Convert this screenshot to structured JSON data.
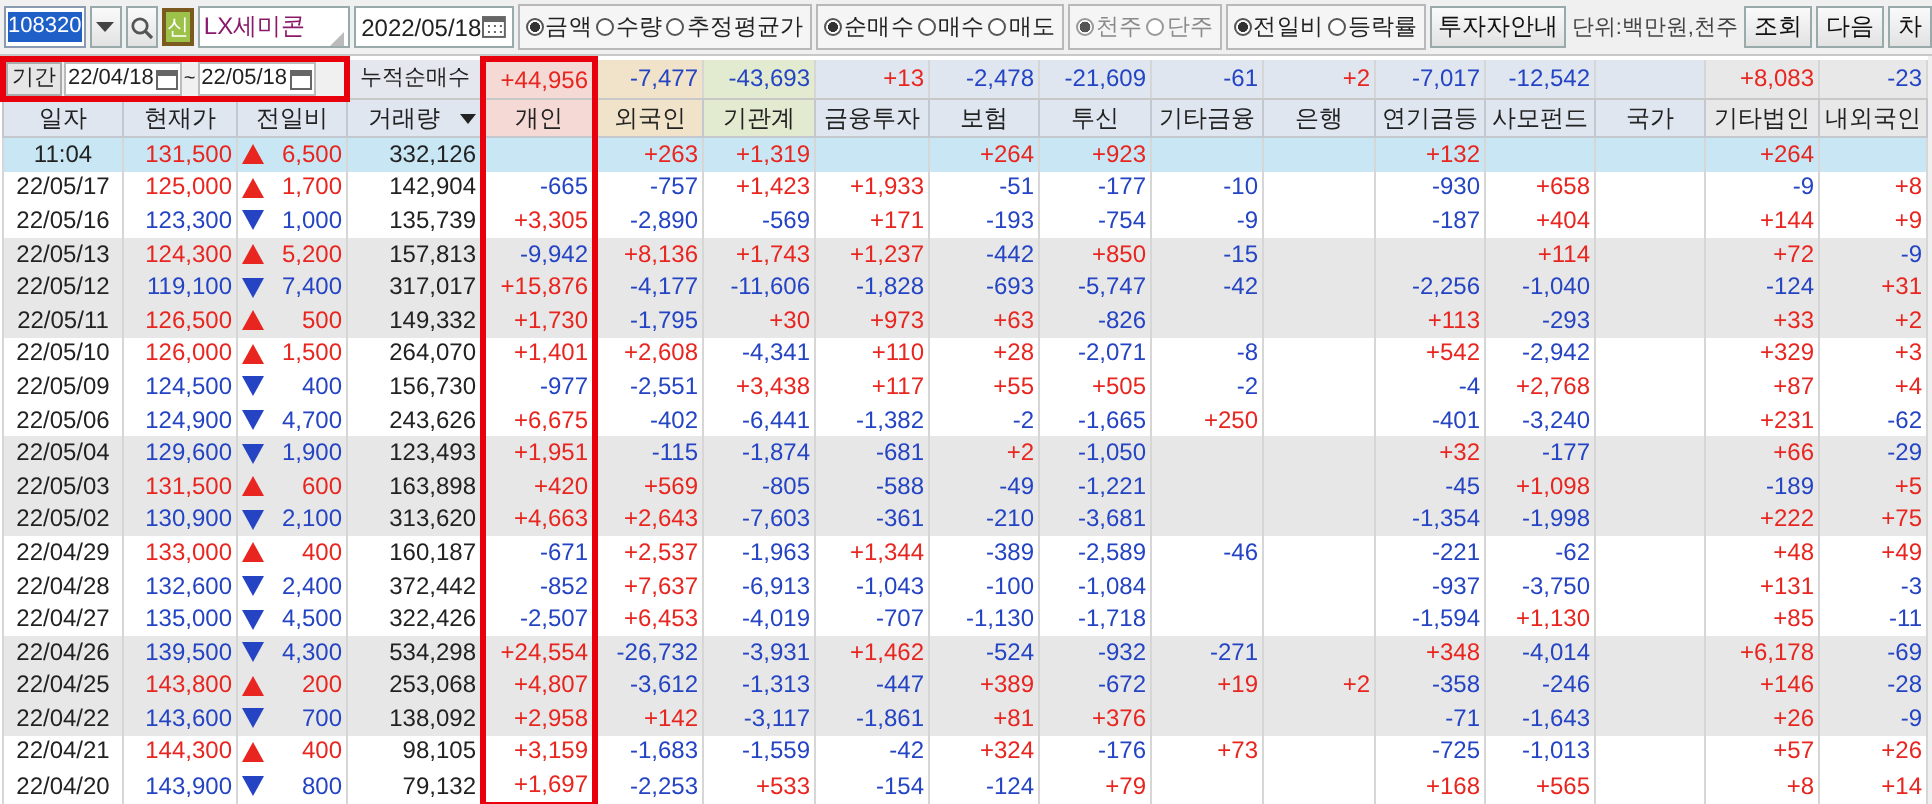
{
  "toolbar": {
    "code": "108320",
    "new_badge": "신",
    "name": "LX세미콘",
    "date": "2022/05/18",
    "radio_groups": [
      {
        "disabled": false,
        "options": [
          {
            "label": "금액",
            "selected": true
          },
          {
            "label": "수량",
            "selected": false
          },
          {
            "label": "추정평균가",
            "selected": false
          }
        ]
      },
      {
        "disabled": false,
        "options": [
          {
            "label": "순매수",
            "selected": true
          },
          {
            "label": "매수",
            "selected": false
          },
          {
            "label": "매도",
            "selected": false
          }
        ]
      },
      {
        "disabled": true,
        "options": [
          {
            "label": "천주",
            "selected": true
          },
          {
            "label": "단주",
            "selected": false
          }
        ]
      },
      {
        "disabled": false,
        "options": [
          {
            "label": "전일비",
            "selected": true
          },
          {
            "label": "등락률",
            "selected": false
          }
        ]
      }
    ],
    "guide_button": "투자자안내",
    "unit": "단위:백만원,천주",
    "buttons": [
      "조회",
      "다음",
      "차"
    ]
  },
  "period": {
    "label": "기간",
    "from": "22/04/18",
    "separator": "~",
    "to": "22/05/18",
    "outlined": true
  },
  "summary_label": "누적순매수",
  "columns": [
    {
      "label": "일자",
      "kind": "plain"
    },
    {
      "label": "현재가",
      "kind": "plain"
    },
    {
      "label": "전일비",
      "kind": "plain"
    },
    {
      "label": "거래량",
      "kind": "dropdown"
    }
  ],
  "investor_columns": [
    {
      "label": "개인",
      "color": "#f5d9d5",
      "outlined": true,
      "total": "+44,956"
    },
    {
      "label": "외국인",
      "color": "#f0e3c9",
      "outlined": false,
      "total": "-7,477"
    },
    {
      "label": "기관계",
      "color": "#e2eacf",
      "outlined": false,
      "total": "-43,693"
    },
    {
      "label": "금융투자",
      "color": "#dfe6ef",
      "outlined": false,
      "total": "+13"
    },
    {
      "label": "보험",
      "color": "#dfe6ef",
      "outlined": false,
      "total": "-2,478"
    },
    {
      "label": "투신",
      "color": "#dfe6ef",
      "outlined": false,
      "total": "-21,609"
    },
    {
      "label": "기타금융",
      "color": "#dfe6ef",
      "outlined": false,
      "total": "-61"
    },
    {
      "label": "은행",
      "color": "#dfe6ef",
      "outlined": false,
      "total": "+2"
    },
    {
      "label": "연기금등",
      "color": "#dfe6ef",
      "outlined": false,
      "total": "-7,017"
    },
    {
      "label": "사모펀드",
      "color": "#dfe6ef",
      "outlined": false,
      "total": "-12,542"
    },
    {
      "label": "국가",
      "color": "#dfe6ef",
      "outlined": false
    },
    {
      "label": "기타법인",
      "color": "#e8e8e8",
      "outlined": false,
      "total": "+8,083"
    },
    {
      "label": "내외국인",
      "color": "#e8e8e8",
      "outlined": false,
      "total": "-23"
    }
  ],
  "rows": [
    {
      "date": "11:04",
      "price": "131,500",
      "rising": true,
      "change": "6,500",
      "volume": "332,126",
      "selected": true,
      "values": [
        {
          "kind": "empty"
        },
        "+263",
        "+1,319",
        {
          "kind": "empty"
        },
        "+264",
        "+923",
        {
          "kind": "empty"
        },
        {
          "kind": "empty"
        },
        "+132",
        {
          "kind": "empty"
        },
        {
          "kind": "empty"
        },
        "+264",
        {
          "kind": "empty"
        }
      ]
    },
    {
      "date": "22/05/17",
      "price": "125,000",
      "rising": true,
      "change": "1,700",
      "volume": "142,904",
      "selected": false,
      "values": [
        "-665",
        "-757",
        "+1,423",
        "+1,933",
        "-51",
        "-177",
        "-10",
        {
          "kind": "empty"
        },
        "-930",
        "+658",
        {
          "kind": "empty"
        },
        "-9",
        "+8"
      ]
    },
    {
      "date": "22/05/16",
      "price": "123,300",
      "rising": false,
      "change": "1,000",
      "volume": "135,739",
      "selected": false,
      "values": [
        "+3,305",
        "-2,890",
        "-569",
        "+171",
        "-193",
        "-754",
        "-9",
        {
          "kind": "empty"
        },
        "-187",
        "+404",
        {
          "kind": "empty"
        },
        "+144",
        "+9"
      ]
    },
    {
      "date": "22/05/13",
      "price": "124,300",
      "rising": true,
      "change": "5,200",
      "volume": "157,813",
      "selected": false,
      "values": [
        "-9,942",
        "+8,136",
        "+1,743",
        "+1,237",
        "-442",
        "+850",
        "-15",
        {
          "kind": "empty"
        },
        {
          "kind": "empty"
        },
        "+114",
        {
          "kind": "empty"
        },
        "+72",
        "-9"
      ]
    },
    {
      "date": "22/05/12",
      "price": "119,100",
      "rising": false,
      "change": "7,400",
      "volume": "317,017",
      "selected": false,
      "values": [
        "+15,876",
        "-4,177",
        "-11,606",
        "-1,828",
        "-693",
        "-5,747",
        "-42",
        {
          "kind": "empty"
        },
        "-2,256",
        "-1,040",
        {
          "kind": "empty"
        },
        "-124",
        "+31"
      ]
    },
    {
      "date": "22/05/11",
      "price": "126,500",
      "rising": true,
      "change": "500",
      "volume": "149,332",
      "selected": false,
      "values": [
        "+1,730",
        "-1,795",
        "+30",
        "+973",
        "+63",
        "-826",
        {
          "kind": "empty"
        },
        {
          "kind": "empty"
        },
        "+113",
        "-293",
        {
          "kind": "empty"
        },
        "+33",
        "+2"
      ]
    },
    {
      "date": "22/05/10",
      "price": "126,000",
      "rising": true,
      "change": "1,500",
      "volume": "264,070",
      "selected": false,
      "values": [
        "+1,401",
        "+2,608",
        "-4,341",
        "+110",
        "+28",
        "-2,071",
        "-8",
        {
          "kind": "empty"
        },
        "+542",
        "-2,942",
        {
          "kind": "empty"
        },
        "+329",
        "+3"
      ]
    },
    {
      "date": "22/05/09",
      "price": "124,500",
      "rising": false,
      "change": "400",
      "volume": "156,730",
      "selected": false,
      "values": [
        "-977",
        "-2,551",
        "+3,438",
        "+117",
        "+55",
        "+505",
        "-2",
        {
          "kind": "empty"
        },
        "-4",
        "+2,768",
        {
          "kind": "empty"
        },
        "+87",
        "+4"
      ]
    },
    {
      "date": "22/05/06",
      "price": "124,900",
      "rising": false,
      "change": "4,700",
      "volume": "243,626",
      "selected": false,
      "values": [
        "+6,675",
        "-402",
        "-6,441",
        "-1,382",
        "-2",
        "-1,665",
        "+250",
        {
          "kind": "empty"
        },
        "-401",
        "-3,240",
        {
          "kind": "empty"
        },
        "+231",
        "-62"
      ]
    },
    {
      "date": "22/05/04",
      "price": "129,600",
      "rising": false,
      "change": "1,900",
      "volume": "123,493",
      "selected": false,
      "values": [
        "+1,951",
        "-115",
        "-1,874",
        "-681",
        "+2",
        "-1,050",
        {
          "kind": "empty"
        },
        {
          "kind": "empty"
        },
        "+32",
        "-177",
        {
          "kind": "empty"
        },
        "+66",
        "-29"
      ]
    },
    {
      "date": "22/05/03",
      "price": "131,500",
      "rising": true,
      "change": "600",
      "volume": "163,898",
      "selected": false,
      "values": [
        "+420",
        "+569",
        "-805",
        "-588",
        "-49",
        "-1,221",
        {
          "kind": "empty"
        },
        {
          "kind": "empty"
        },
        "-45",
        "+1,098",
        {
          "kind": "empty"
        },
        "-189",
        "+5"
      ]
    },
    {
      "date": "22/05/02",
      "price": "130,900",
      "rising": false,
      "change": "2,100",
      "volume": "313,620",
      "selected": false,
      "values": [
        "+4,663",
        "+2,643",
        "-7,603",
        "-361",
        "-210",
        "-3,681",
        {
          "kind": "empty"
        },
        {
          "kind": "empty"
        },
        "-1,354",
        "-1,998",
        {
          "kind": "empty"
        },
        "+222",
        "+75"
      ]
    },
    {
      "date": "22/04/29",
      "price": "133,000",
      "rising": true,
      "change": "400",
      "volume": "160,187",
      "selected": false,
      "values": [
        "-671",
        "+2,537",
        "-1,963",
        "+1,344",
        "-389",
        "-2,589",
        "-46",
        {
          "kind": "empty"
        },
        "-221",
        "-62",
        {
          "kind": "empty"
        },
        "+48",
        "+49"
      ]
    },
    {
      "date": "22/04/28",
      "price": "132,600",
      "rising": false,
      "change": "2,400",
      "volume": "372,442",
      "selected": false,
      "values": [
        "-852",
        "+7,637",
        "-6,913",
        "-1,043",
        "-100",
        "-1,084",
        {
          "kind": "empty"
        },
        {
          "kind": "empty"
        },
        "-937",
        "-3,750",
        {
          "kind": "empty"
        },
        "+131",
        "-3"
      ]
    },
    {
      "date": "22/04/27",
      "price": "135,000",
      "rising": false,
      "change": "4,500",
      "volume": "322,426",
      "selected": false,
      "values": [
        "-2,507",
        "+6,453",
        "-4,019",
        "-707",
        "-1,130",
        "-1,718",
        {
          "kind": "empty"
        },
        {
          "kind": "empty"
        },
        "-1,594",
        "+1,130",
        {
          "kind": "empty"
        },
        "+85",
        "-11"
      ]
    },
    {
      "date": "22/04/26",
      "price": "139,500",
      "rising": false,
      "change": "4,300",
      "volume": "534,298",
      "selected": false,
      "values": [
        "+24,554",
        "-26,732",
        "-3,931",
        "+1,462",
        "-524",
        "-932",
        "-271",
        {
          "kind": "empty"
        },
        "+348",
        "-4,014",
        {
          "kind": "empty"
        },
        "+6,178",
        "-69"
      ]
    },
    {
      "date": "22/04/25",
      "price": "143,800",
      "rising": true,
      "change": "200",
      "volume": "253,068",
      "selected": false,
      "values": [
        "+4,807",
        "-3,612",
        "-1,313",
        "-447",
        "+389",
        "-672",
        "+19",
        "+2",
        "-358",
        "-246",
        {
          "kind": "empty"
        },
        "+146",
        "-28"
      ]
    },
    {
      "date": "22/04/22",
      "price": "143,600",
      "rising": false,
      "change": "700",
      "volume": "138,092",
      "selected": false,
      "values": [
        "+2,958",
        "+142",
        "-3,117",
        "-1,861",
        "+81",
        "+376",
        {
          "kind": "empty"
        },
        {
          "kind": "empty"
        },
        "-71",
        "-1,643",
        {
          "kind": "empty"
        },
        "+26",
        "-9"
      ]
    },
    {
      "date": "22/04/21",
      "price": "144,300",
      "rising": true,
      "change": "400",
      "volume": "98,105",
      "selected": false,
      "values": [
        "+3,159",
        "-1,683",
        "-1,559",
        "-42",
        "+324",
        "-176",
        "+73",
        {
          "kind": "empty"
        },
        "-725",
        "-1,013",
        {
          "kind": "empty"
        },
        "+57",
        "+26"
      ]
    },
    {
      "date": "22/04/20",
      "price": "143,900",
      "rising": false,
      "change": "800",
      "volume": "79,132",
      "selected": false,
      "values": [
        "+1,697",
        "-2,253",
        "+533",
        "-154",
        "-124",
        "+79",
        {
          "kind": "empty"
        },
        {
          "kind": "empty"
        },
        "+168",
        "+565",
        {
          "kind": "empty"
        },
        "+8",
        "+14"
      ]
    }
  ]
}
